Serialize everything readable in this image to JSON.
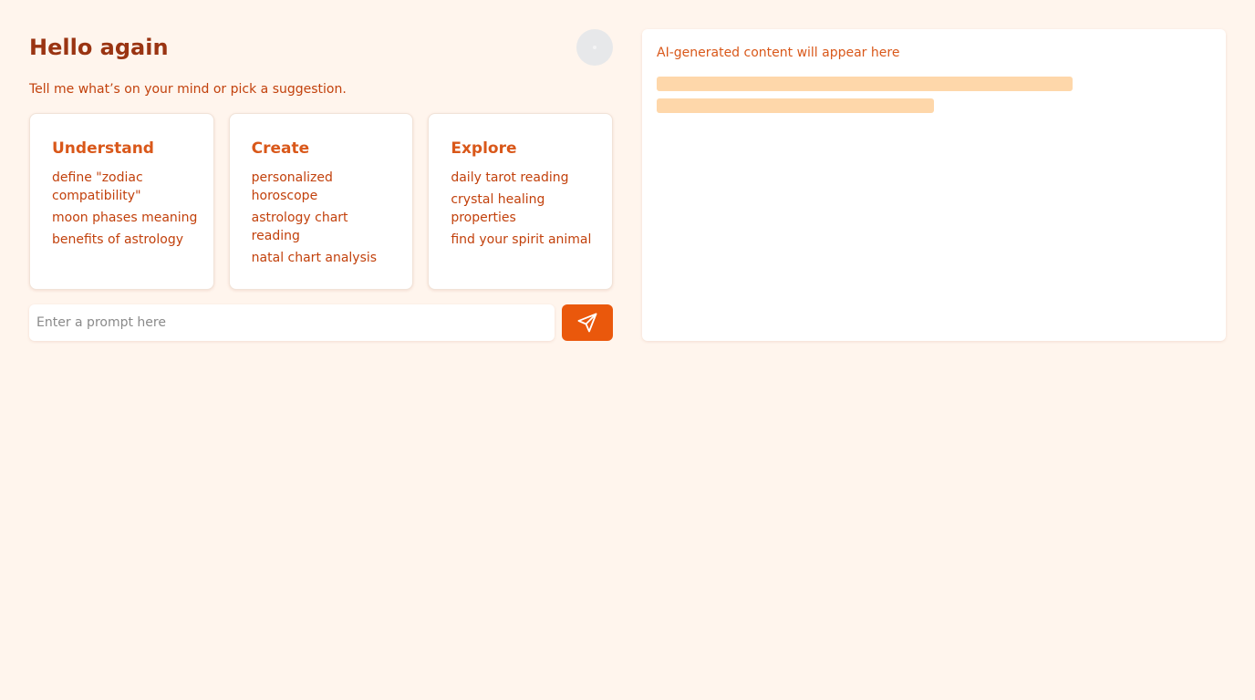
{
  "greeting": "Hello again",
  "subtitle": "Tell me what’s on your mind or pick a suggestion.",
  "suggestions": [
    {
      "title": "Understand",
      "items": [
        "define \"zodiac compatibility\"",
        "moon phases meaning",
        "benefits of astrology"
      ]
    },
    {
      "title": "Create",
      "items": [
        "personalized horoscope",
        "astrology chart reading",
        "natal chart analysis"
      ]
    },
    {
      "title": "Explore",
      "items": [
        "daily tarot reading",
        "crystal healing properties",
        "find your spirit animal"
      ]
    }
  ],
  "prompt": {
    "placeholder": "Enter a prompt here",
    "value": ""
  },
  "send_icon": "send-icon",
  "output": {
    "placeholder_text": "AI-generated content will appear here"
  },
  "colors": {
    "background": "#fff5ed",
    "heading": "#9a3412",
    "accent": "#ea580c",
    "text": "#c2410c",
    "skeleton": "#fed7aa",
    "avatar": "#e7e8ea"
  }
}
